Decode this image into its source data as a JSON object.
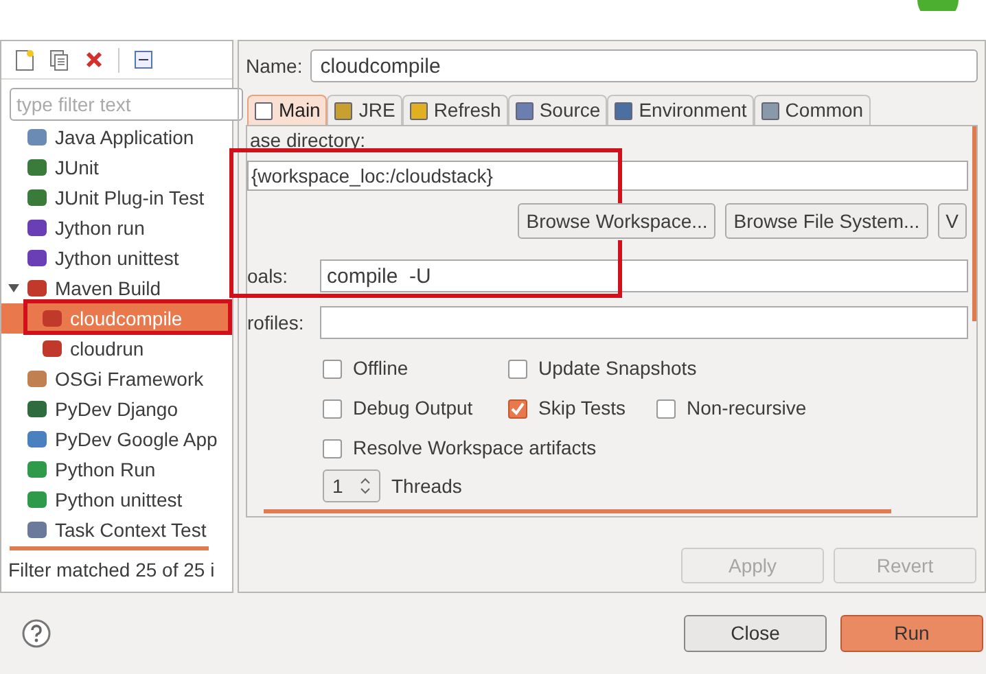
{
  "sidebar": {
    "filter": {
      "placeholder": "type filter text"
    },
    "items": [
      {
        "label": "Java Application",
        "selected": false
      },
      {
        "label": "JUnit",
        "selected": false
      },
      {
        "label": "JUnit Plug-in Test",
        "selected": false
      },
      {
        "label": "Jython run",
        "selected": false
      },
      {
        "label": "Jython unittest",
        "selected": false
      },
      {
        "label": "Maven Build",
        "selected": false,
        "expanded": true,
        "children": [
          {
            "label": "cloudcompile",
            "selected": true
          },
          {
            "label": "cloudrun",
            "selected": false
          }
        ]
      },
      {
        "label": "OSGi Framework",
        "selected": false
      },
      {
        "label": "PyDev Django",
        "selected": false
      },
      {
        "label": "PyDev Google App",
        "selected": false
      },
      {
        "label": "Python Run",
        "selected": false
      },
      {
        "label": "Python unittest",
        "selected": false
      },
      {
        "label": "Task Context Test",
        "selected": false
      }
    ],
    "status": "Filter matched 25 of 25 i"
  },
  "name": {
    "label": "Name:",
    "value": "cloudcompile"
  },
  "tabs": [
    {
      "label": "Main",
      "selected": true
    },
    {
      "label": "JRE",
      "selected": false
    },
    {
      "label": "Refresh",
      "selected": false
    },
    {
      "label": "Source",
      "selected": false
    },
    {
      "label": "Environment",
      "selected": false
    },
    {
      "label": "Common",
      "selected": false
    }
  ],
  "main": {
    "base_directory_label": "ase directory:",
    "base_directory": "{workspace_loc:/cloudstack}",
    "buttons": [
      "Browse Workspace...",
      "Browse File System...",
      "V"
    ],
    "goals_label": "oals:",
    "goals": "compile  -U",
    "profiles_label": "rofiles:",
    "checkbox_rows": [
      [
        {
          "label": "Offline",
          "checked": false
        },
        {
          "label": "Update Snapshots",
          "checked": false
        }
      ],
      [
        {
          "label": "Debug Output",
          "checked": false
        },
        {
          "label": "Skip Tests",
          "checked": true
        },
        {
          "label": "Non-recursive",
          "checked": false
        }
      ],
      [
        {
          "label": "Resolve Workspace artifacts",
          "checked": false
        }
      ]
    ],
    "threads": {
      "value": "1",
      "label": "Threads"
    }
  },
  "panel_buttons": [
    {
      "label": "Apply",
      "disabled": true
    },
    {
      "label": "Revert",
      "disabled": true
    }
  ],
  "dialog_buttons": [
    {
      "label": "Close",
      "kind": "normal"
    },
    {
      "label": "Run",
      "kind": "default"
    }
  ]
}
